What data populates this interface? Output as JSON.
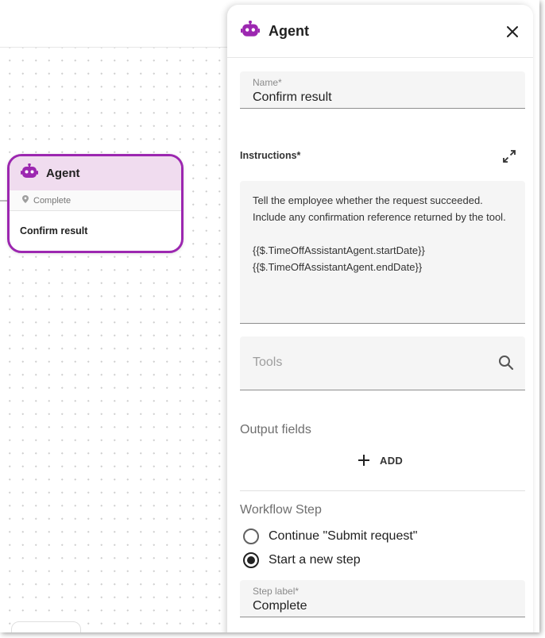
{
  "canvas": {
    "node": {
      "title": "Agent",
      "subtitle": "Complete",
      "body": "Confirm result"
    }
  },
  "panel": {
    "title": "Agent",
    "name_field": {
      "label": "Name*",
      "value": "Confirm result"
    },
    "instructions": {
      "label": "Instructions*",
      "lines": [
        "Tell the employee whether the request succeeded.",
        "Include any confirmation reference returned by the tool.",
        "",
        "{{$.TimeOffAssistantAgent.startDate}}",
        "{{$.TimeOffAssistantAgent.endDate}}"
      ]
    },
    "tools": {
      "placeholder": "Tools"
    },
    "output_fields": {
      "heading": "Output fields",
      "add_label": "ADD"
    },
    "workflow_step": {
      "heading": "Workflow Step",
      "options": [
        {
          "label": "Continue \"Submit request\"",
          "selected": false
        },
        {
          "label": "Start a new step",
          "selected": true
        }
      ]
    },
    "step_label_field": {
      "label": "Step label*",
      "value": "Complete"
    }
  },
  "colors": {
    "accent": "#9c27b0",
    "node_header": "#f0dcef",
    "field_bg": "#f5f5f5"
  },
  "icons": [
    "robot-icon",
    "location-pin-icon",
    "close-icon",
    "expand-icon",
    "search-icon",
    "plus-icon"
  ]
}
